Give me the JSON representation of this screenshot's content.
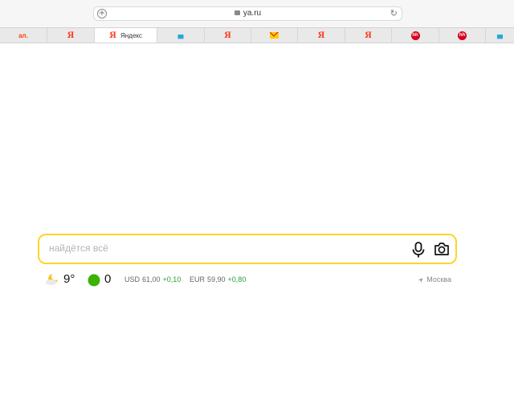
{
  "browser": {
    "url": "ya.ru",
    "new_tab_icon": "plus-circle-icon",
    "reload_icon": "reload-icon"
  },
  "tabs": [
    {
      "glyph": "ал.",
      "icon": "market-icon",
      "kind": "market"
    },
    {
      "glyph": "Я",
      "icon": "yandex-logo-icon",
      "kind": "ya"
    },
    {
      "glyph": "Я",
      "label": "Яндекс",
      "icon": "yandex-logo-icon",
      "kind": "active"
    },
    {
      "glyph": "▄",
      "icon": "gift-icon",
      "kind": "gift"
    },
    {
      "glyph": "Я",
      "icon": "yandex-logo-icon",
      "kind": "ya"
    },
    {
      "glyph": "",
      "icon": "mail-icon",
      "kind": "mail"
    },
    {
      "glyph": "Я",
      "icon": "yandex-logo-icon",
      "kind": "ya"
    },
    {
      "glyph": "Я",
      "icon": "yandex-logo-icon",
      "kind": "ya"
    },
    {
      "glyph": "hh",
      "icon": "hh-logo-icon",
      "kind": "hh"
    },
    {
      "glyph": "hh",
      "icon": "hh-logo-icon",
      "kind": "hh"
    },
    {
      "glyph": "▄",
      "icon": "gift-icon",
      "kind": "gift"
    }
  ],
  "search": {
    "placeholder": "найдётся всё",
    "mic_icon": "microphone-icon",
    "camera_icon": "camera-search-icon",
    "border_color": "#fed42b"
  },
  "informers": {
    "weather": {
      "temp": "9°",
      "icon": "cloudy-moon-icon"
    },
    "traffic": {
      "value": "0",
      "icon": "traffic-green-icon",
      "color": "#3bb300"
    },
    "rates": [
      {
        "code": "USD",
        "value": "61,00",
        "delta": "+0,10"
      },
      {
        "code": "EUR",
        "value": "59,90",
        "delta": "+0,80"
      }
    ],
    "city": "Москва",
    "delta_color": "#21a038"
  }
}
